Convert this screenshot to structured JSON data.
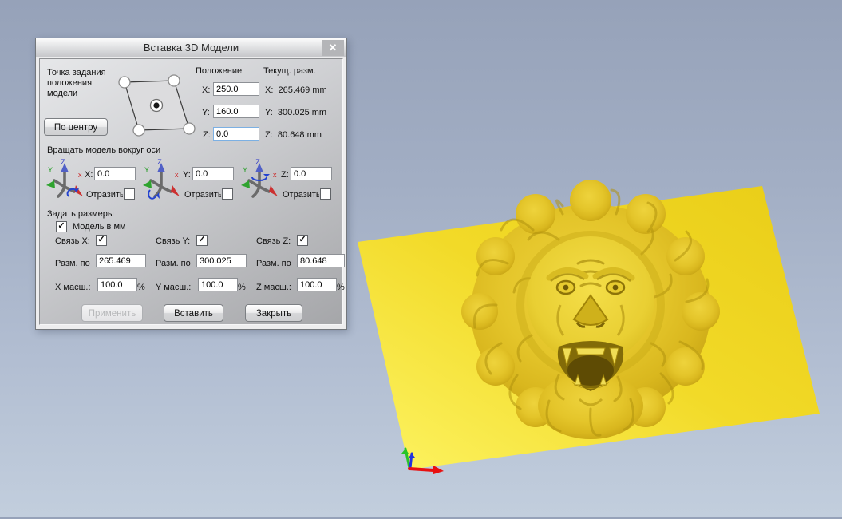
{
  "colors": {
    "viewport_top": "#96a2b9",
    "viewport_bottom": "#c2cedd",
    "plane_yellow": "#f0d724",
    "model_gold": "#e2c428",
    "dialog_bg": "#cfd0d3",
    "field_focus_border": "#7cb0e3"
  },
  "icons": {
    "check": "✓",
    "close": "✕"
  },
  "axis_triad": {
    "x": "x",
    "y": "Y",
    "z": "Z"
  },
  "dialog": {
    "title": "Вставка 3D Модели",
    "anchor_section": {
      "description": "Точка задания положения модели",
      "center_button": "По центру"
    },
    "position": {
      "header": "Положение",
      "current_header": "Текущ. разм.",
      "rows": [
        {
          "axis": "X:",
          "value": "250.0",
          "cur_label": "X:",
          "cur_value": "265.469",
          "unit": "mm"
        },
        {
          "axis": "Y:",
          "value": "160.0",
          "cur_label": "Y:",
          "cur_value": "300.025",
          "unit": "mm"
        },
        {
          "axis": "Z:",
          "value": "0.0",
          "cur_label": "Z:",
          "cur_value": "80.648",
          "unit": "mm"
        }
      ]
    },
    "rotation": {
      "header": "Вращать модель вокруг оси",
      "columns": [
        {
          "axis_label": "X:",
          "angle": "0.0",
          "mirror_label": "Отразить"
        },
        {
          "axis_label": "Y:",
          "angle": "0.0",
          "mirror_label": "Отразить"
        },
        {
          "axis_label": "Z:",
          "angle": "0.0",
          "mirror_label": "Отразить"
        }
      ]
    },
    "sizes": {
      "header": "Задать размеры",
      "model_mm_label": "Модель в мм",
      "columns": [
        {
          "link_label": "Связь X:",
          "size_label": "Разм. по",
          "size_value": "265.469",
          "scale_label": "X масш.:",
          "scale_value": "100.0",
          "percent": "%"
        },
        {
          "link_label": "Связь Y:",
          "size_label": "Разм. по",
          "size_value": "300.025",
          "scale_label": "Y масш.:",
          "scale_value": "100.0",
          "percent": "%"
        },
        {
          "link_label": "Связь Z:",
          "size_label": "Разм. по",
          "size_value": "80.648",
          "scale_label": "Z масш.:",
          "scale_value": "100.0",
          "percent": "%"
        }
      ]
    },
    "buttons": {
      "apply": "Применить",
      "insert": "Вставить",
      "close": "Закрыть"
    }
  }
}
